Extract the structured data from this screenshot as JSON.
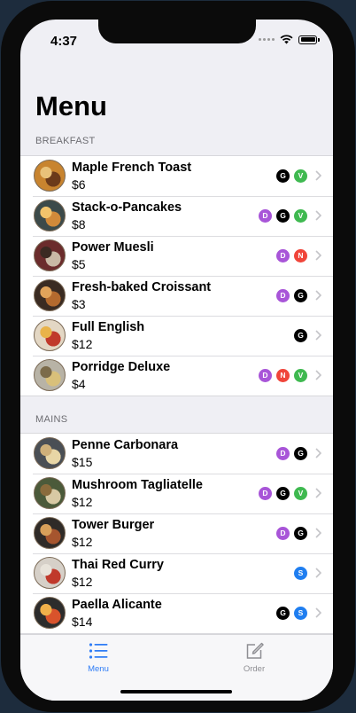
{
  "status_bar": {
    "time": "4:37"
  },
  "page_title": "Menu",
  "colors": {
    "accent": "#2f7df6",
    "badge_D": "#a855d8",
    "badge_G": "#000000",
    "badge_V": "#3fb950",
    "badge_N": "#f0453a",
    "badge_S": "#1f7ef0"
  },
  "sections": [
    {
      "title": "BREAKFAST",
      "items": [
        {
          "name": "Maple French Toast",
          "price": "$6",
          "tags": [
            "G",
            "V"
          ],
          "thumb": "french-toast"
        },
        {
          "name": "Stack-o-Pancakes",
          "price": "$8",
          "tags": [
            "D",
            "G",
            "V"
          ],
          "thumb": "pancakes"
        },
        {
          "name": "Power Muesli",
          "price": "$5",
          "tags": [
            "D",
            "N"
          ],
          "thumb": "muesli"
        },
        {
          "name": "Fresh-baked Croissant",
          "price": "$3",
          "tags": [
            "D",
            "G"
          ],
          "thumb": "croissant"
        },
        {
          "name": "Full English",
          "price": "$12",
          "tags": [
            "G"
          ],
          "thumb": "full-english"
        },
        {
          "name": "Porridge Deluxe",
          "price": "$4",
          "tags": [
            "D",
            "N",
            "V"
          ],
          "thumb": "porridge"
        }
      ]
    },
    {
      "title": "MAINS",
      "items": [
        {
          "name": "Penne Carbonara",
          "price": "$15",
          "tags": [
            "D",
            "G"
          ],
          "thumb": "penne"
        },
        {
          "name": "Mushroom Tagliatelle",
          "price": "$12",
          "tags": [
            "D",
            "G",
            "V"
          ],
          "thumb": "tagliatelle"
        },
        {
          "name": "Tower Burger",
          "price": "$12",
          "tags": [
            "D",
            "G"
          ],
          "thumb": "burger"
        },
        {
          "name": "Thai Red Curry",
          "price": "$12",
          "tags": [
            "S"
          ],
          "thumb": "curry"
        },
        {
          "name": "Paella Alicante",
          "price": "$14",
          "tags": [
            "G",
            "S"
          ],
          "thumb": "paella"
        }
      ]
    }
  ],
  "tab_bar": {
    "tabs": [
      {
        "label": "Menu",
        "icon": "list-icon",
        "selected": true
      },
      {
        "label": "Order",
        "icon": "compose-icon",
        "selected": false
      }
    ]
  }
}
